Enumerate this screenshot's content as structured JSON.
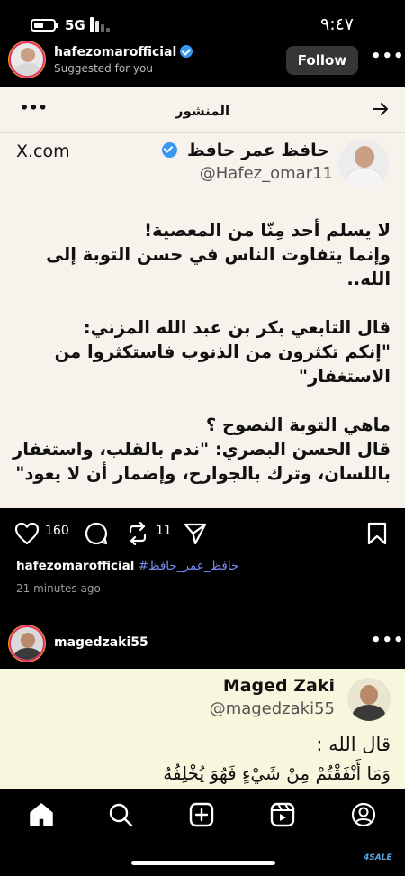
{
  "status_bar": {
    "network": "5G",
    "time": "٩:٤٧"
  },
  "suggested": {
    "username": "hafezomarofficial",
    "subtitle": "Suggested for you",
    "follow_label": "Follow",
    "more_icon": "more-horizontal-icon"
  },
  "post1": {
    "header_title": "المنشور",
    "display_name": "حافظ عمر حافظ",
    "handle": "@Hafez_omar11",
    "source": "X.com",
    "body": "لا يسلم أحد مِنّا من المعصية!\nوإنما يتفاوت الناس في حسن التوبة إلى الله..\n\nقال التابعي بكر بن عبد الله المزني:\n\"إنكم تكثرون من الذنوب فاستكثروا من الاستغفار\"\n\nماهي التوبة النصوح ؟\nقال الحسن البصري: \"ندم بالقلب، واستغفار باللسان، وترك بالجوارح، وإضمار أن لا يعود\"",
    "likes": "160",
    "reposts": "11",
    "caption_user": "hafezomarofficial",
    "caption_tag": "#حافظ_عمر_حافظ",
    "time_ago": "21 minutes ago"
  },
  "post2": {
    "username": "magedzaki55",
    "tweet_name": "Maged Zaki",
    "tweet_handle": "@magedzaki55",
    "line1": "قال الله :",
    "line2": "وَمَا أَنْفَقْتُمْ مِنْ شَيْءٍ فَهُوَ يُخْلِفُهُ"
  },
  "nav": {
    "icons": [
      "home-icon",
      "search-icon",
      "create-icon",
      "reels-icon",
      "profile-icon"
    ]
  },
  "watermark": "4SALE",
  "colors": {
    "accent_blue": "#3897f0",
    "hashtag": "#7b8cf5",
    "card1_bg": "#f7f3ec",
    "card2_bg": "#f8f6dc"
  }
}
